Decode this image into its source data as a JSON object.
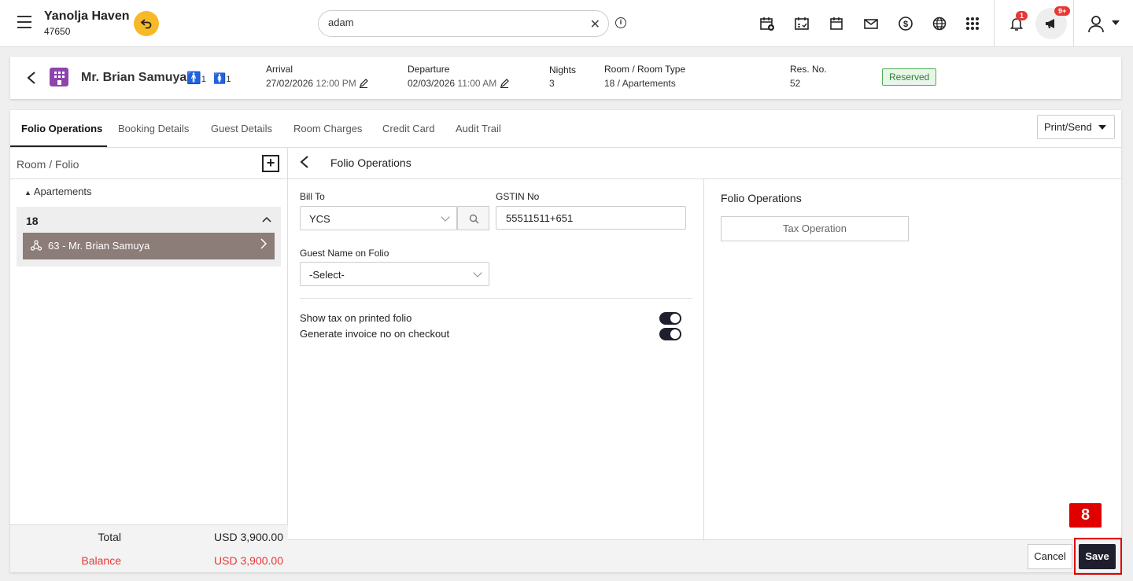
{
  "app": {
    "name": "Yanolja Haven",
    "code": "47650"
  },
  "search": {
    "value": "adam",
    "clear": "✕"
  },
  "notifications": {
    "bell_count": "1",
    "announce_count": "9+"
  },
  "reservation": {
    "guest": "Mr. Brian Samuya",
    "adults": "1",
    "children": "1",
    "arrival_label": "Arrival",
    "arrival_date": "27/02/2026",
    "arrival_time": "12:00 PM",
    "departure_label": "Departure",
    "departure_date": "02/03/2026",
    "departure_time": "11:00 AM",
    "nights_label": "Nights",
    "nights": "3",
    "room_label": "Room / Room Type",
    "room": "18 / Apartements",
    "resno_label": "Res. No.",
    "resno": "52",
    "status": "Reserved"
  },
  "tabs": [
    "Folio Operations",
    "Booking Details",
    "Guest Details",
    "Room Charges",
    "Credit Card",
    "Audit Trail"
  ],
  "print_send": "Print/Send",
  "left": {
    "header": "Room / Folio",
    "group": "Apartements",
    "room": "18",
    "folio": "63 - Mr. Brian Samuya",
    "total_label": "Total",
    "total_value": "USD 3,900.00",
    "balance_label": "Balance",
    "balance_value": "USD 3,900.00"
  },
  "form": {
    "header": "Folio Operations",
    "bill_to_label": "Bill To",
    "bill_to_value": "YCS",
    "gstin_label": "GSTIN No",
    "gstin_value": "55511511+651",
    "guest_name_label": "Guest Name on Folio",
    "guest_name_value": "-Select-",
    "toggle1": "Show tax on printed folio",
    "toggle2": "Generate invoice no on checkout"
  },
  "right": {
    "title": "Folio Operations",
    "tax_button": "Tax Operation"
  },
  "footer": {
    "cancel": "Cancel",
    "save": "Save"
  },
  "step": "8",
  "colors": {
    "accent": "#1e1e2c",
    "status_green": "#4caf50",
    "balance_red": "#e53935",
    "highlight": "#e00000"
  }
}
